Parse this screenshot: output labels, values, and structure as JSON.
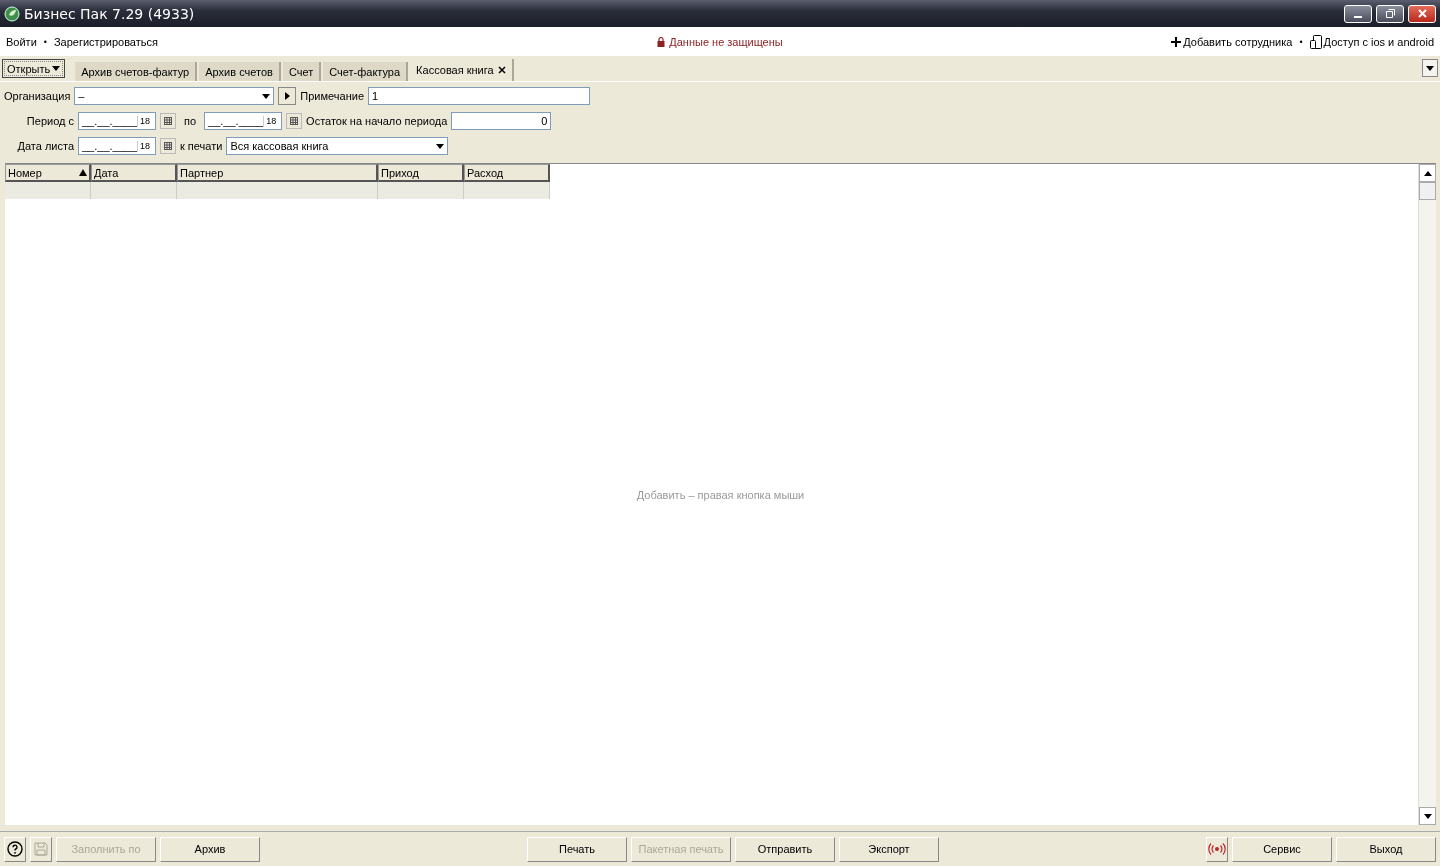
{
  "window": {
    "title": "Бизнес Пак 7.29 (4933)"
  },
  "top_bar": {
    "separator": "•",
    "left_links": [
      "Войти",
      "Зарегистрироваться"
    ],
    "status": "Данные не защищены",
    "right_links": [
      {
        "label": "Добавить сотрудника",
        "kind": "plus"
      },
      {
        "label": "Доступ с ios и android",
        "kind": "phone"
      }
    ]
  },
  "tabs": {
    "open_button": "Открыть",
    "items": [
      {
        "label": "Архив счетов-фактур",
        "selected": false
      },
      {
        "label": "Архив счетов",
        "selected": false
      },
      {
        "label": "Счет",
        "selected": false
      },
      {
        "label": "Счет-фактура",
        "selected": false
      },
      {
        "label": "Кассовая книга",
        "selected": true
      }
    ]
  },
  "form": {
    "organization": {
      "label": "Организация",
      "value": "–"
    },
    "note": {
      "label": "Примечание",
      "value": "1"
    },
    "period_from": {
      "label": "Период с",
      "value": "__.__.____",
      "calendar": "18"
    },
    "period_to": {
      "label": "по",
      "value": "__.__.____",
      "calendar": "18"
    },
    "opening_balance": {
      "label": "Остаток на начало периода",
      "value": "0"
    },
    "sheet_date": {
      "label": "Дата листа",
      "value": "__.__.____",
      "calendar": "18"
    },
    "print": {
      "label": "к печати",
      "value": "Вся кассовая книга"
    }
  },
  "table": {
    "columns": [
      {
        "label": "Номер",
        "sorted": true
      },
      {
        "label": "Дата",
        "sorted": false
      },
      {
        "label": "Партнер",
        "sorted": false
      },
      {
        "label": "Приход",
        "sorted": false
      },
      {
        "label": "Расход",
        "sorted": false
      }
    ],
    "empty_hint": "Добавить – правая кнопка мыши"
  },
  "bottom_bar": {
    "buttons": [
      {
        "kind": "help",
        "disabled": false
      },
      {
        "kind": "save",
        "disabled": true
      },
      {
        "kind": "text",
        "label": "Заполнить по",
        "disabled": true
      },
      {
        "kind": "text",
        "label": "Архив",
        "disabled": false
      },
      {
        "kind": "spacer"
      },
      {
        "kind": "text",
        "label": "Печать",
        "disabled": false
      },
      {
        "kind": "text",
        "label": "Пакетная печать",
        "disabled": true
      },
      {
        "kind": "text",
        "label": "Отправить",
        "disabled": false
      },
      {
        "kind": "text",
        "label": "Экспорт",
        "disabled": false
      },
      {
        "kind": "spacer"
      },
      {
        "kind": "signal",
        "disabled": false
      },
      {
        "kind": "text",
        "label": "Сервис",
        "disabled": false
      },
      {
        "kind": "text",
        "label": "Выход",
        "disabled": false
      }
    ]
  }
}
